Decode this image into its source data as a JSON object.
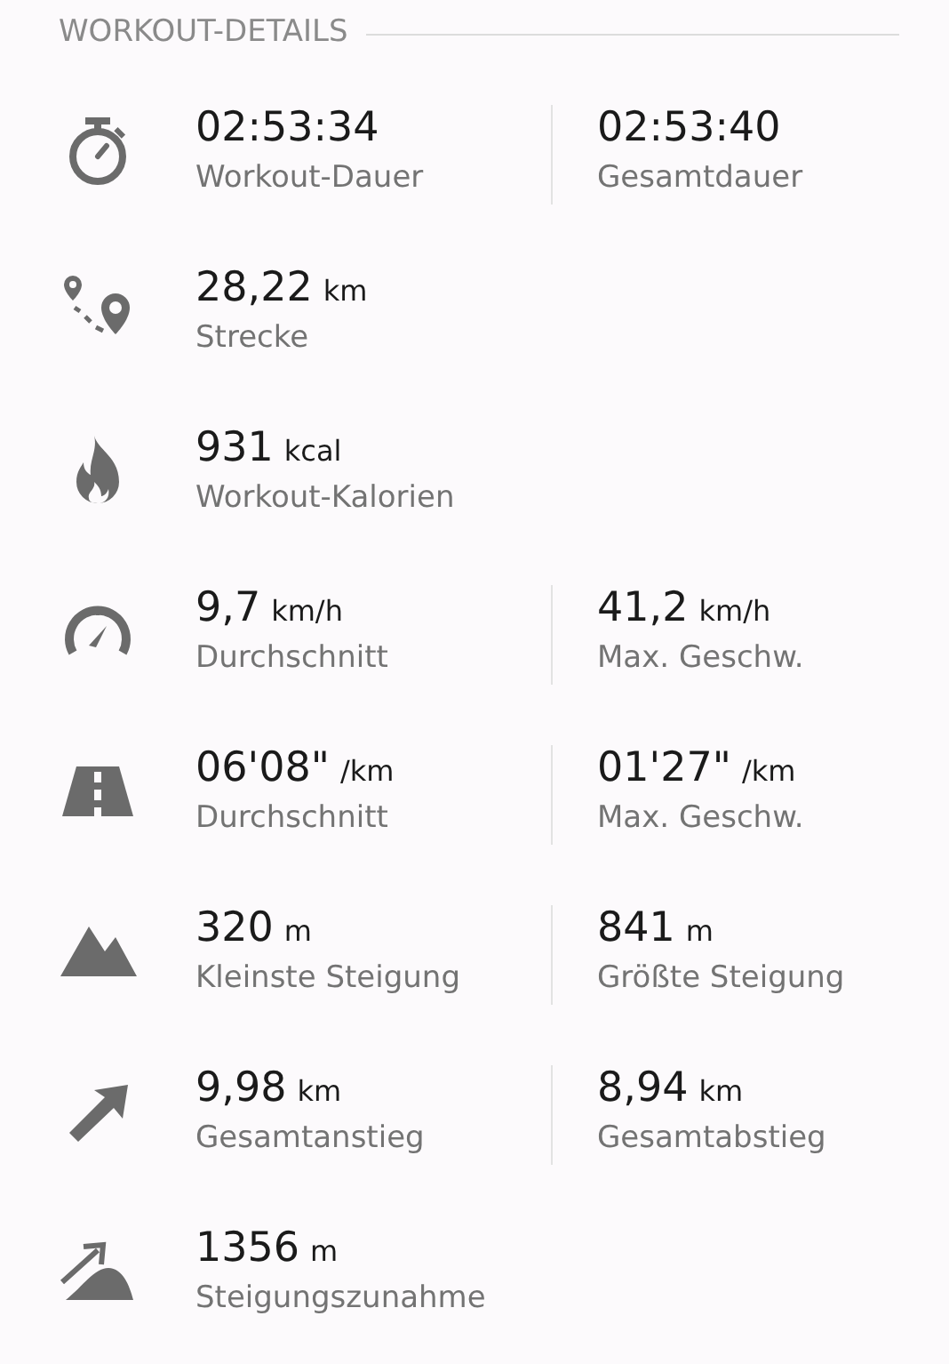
{
  "section": {
    "title": "WORKOUT-DETAILS"
  },
  "rows": [
    {
      "kind": "stopwatch",
      "stats": [
        {
          "value": "02:53:34",
          "label": "Workout-Dauer"
        },
        {
          "value": "02:53:40",
          "label": "Gesamtdauer"
        }
      ]
    },
    {
      "kind": "route",
      "stats": [
        {
          "value": "28,22",
          "unit": "km",
          "label": "Strecke"
        }
      ]
    },
    {
      "kind": "flame",
      "stats": [
        {
          "value": "931",
          "unit": "kcal",
          "label": "Workout-Kalorien"
        }
      ]
    },
    {
      "kind": "speedometer",
      "stats": [
        {
          "value": "9,7",
          "unit": "km/h",
          "label": "Durchschnitt"
        },
        {
          "value": "41,2",
          "unit": "km/h",
          "label": "Max. Geschw."
        }
      ]
    },
    {
      "kind": "road",
      "stats": [
        {
          "value": "06'08\"",
          "unit": "/km",
          "label": "Durchschnitt"
        },
        {
          "value": "01'27\"",
          "unit": "/km",
          "label": "Max. Geschw."
        }
      ]
    },
    {
      "kind": "mountain",
      "stats": [
        {
          "value": "320",
          "unit": "m",
          "label": "Kleinste Steigung"
        },
        {
          "value": "841",
          "unit": "m",
          "label": "Größte Steigung"
        }
      ]
    },
    {
      "kind": "arrow",
      "stats": [
        {
          "value": "9,98",
          "unit": "km",
          "label": "Gesamtanstieg"
        },
        {
          "value": "8,94",
          "unit": "km",
          "label": "Gesamtabstieg"
        }
      ]
    },
    {
      "kind": "hill",
      "stats": [
        {
          "value": "1356",
          "unit": "m",
          "label": "Steigungszunahme"
        }
      ]
    }
  ]
}
